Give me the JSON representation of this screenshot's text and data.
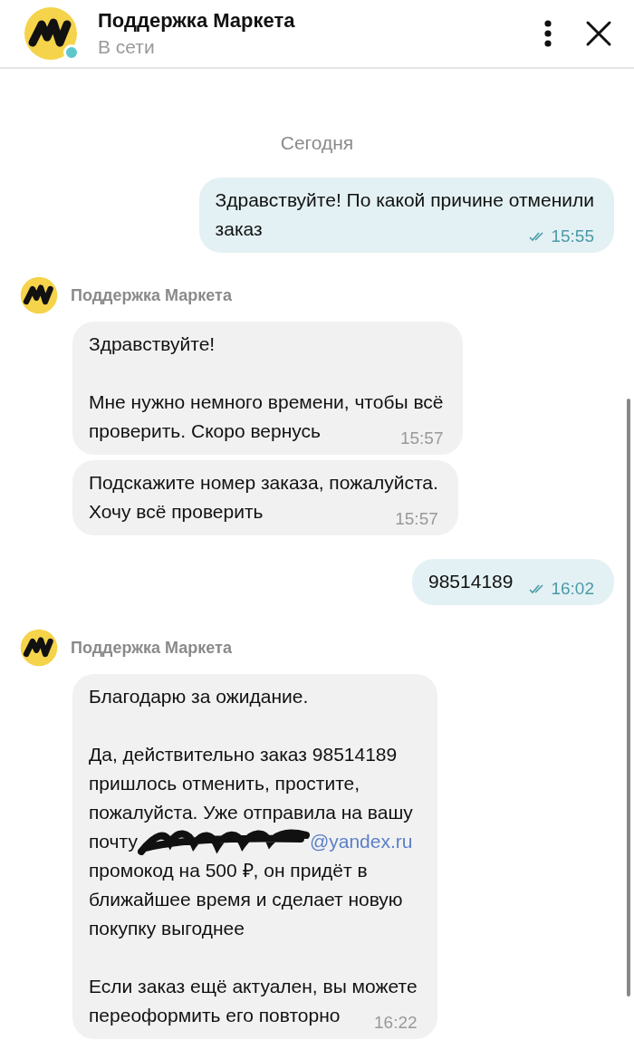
{
  "header": {
    "title": "Поддержка Маркета",
    "status": "В сети",
    "online": true
  },
  "messages": [
    {
      "kind": "date",
      "text": "Сегодня"
    },
    {
      "kind": "outgoing",
      "text": "Здравствуйте! По какой причине отменили\nзаказ",
      "time": "15:55",
      "read": true
    },
    {
      "kind": "incoming",
      "sender": "Поддержка Маркета",
      "bubbles": [
        {
          "parts": [
            {
              "kind": "text",
              "text": "Здравствуйте!\n\nМне нужно немного времени, чтобы всё\nпроверить. Скоро вернусь"
            }
          ],
          "time": "15:57"
        },
        {
          "parts": [
            {
              "kind": "text",
              "text": "Подскажите номер заказа, пожалуйста.\nХочу всё проверить"
            }
          ],
          "time": "15:57"
        }
      ]
    },
    {
      "kind": "outgoing",
      "text": "98514189",
      "time": "16:02",
      "read": true
    },
    {
      "kind": "incoming",
      "sender": "Поддержка Маркета",
      "bubbles": [
        {
          "parts": [
            {
              "kind": "text",
              "text": "Благодарю за ожидание.\n\nДа, действительно заказ 98514189\nпришлось отменить, простите,\nпожалуйста. Уже отправила на вашу\nпочту"
            },
            {
              "kind": "redacted"
            },
            {
              "kind": "link",
              "text": "@yandex.ru"
            },
            {
              "kind": "text",
              "text": "\nпромокод на 500 ₽, он придёт в\nближайшее время и сделает новую\nпокупку выгоднее\n\nЕсли заказ ещё актуален, вы можете\nпереоформить его повторно"
            }
          ],
          "time": "16:22"
        }
      ]
    }
  ]
}
